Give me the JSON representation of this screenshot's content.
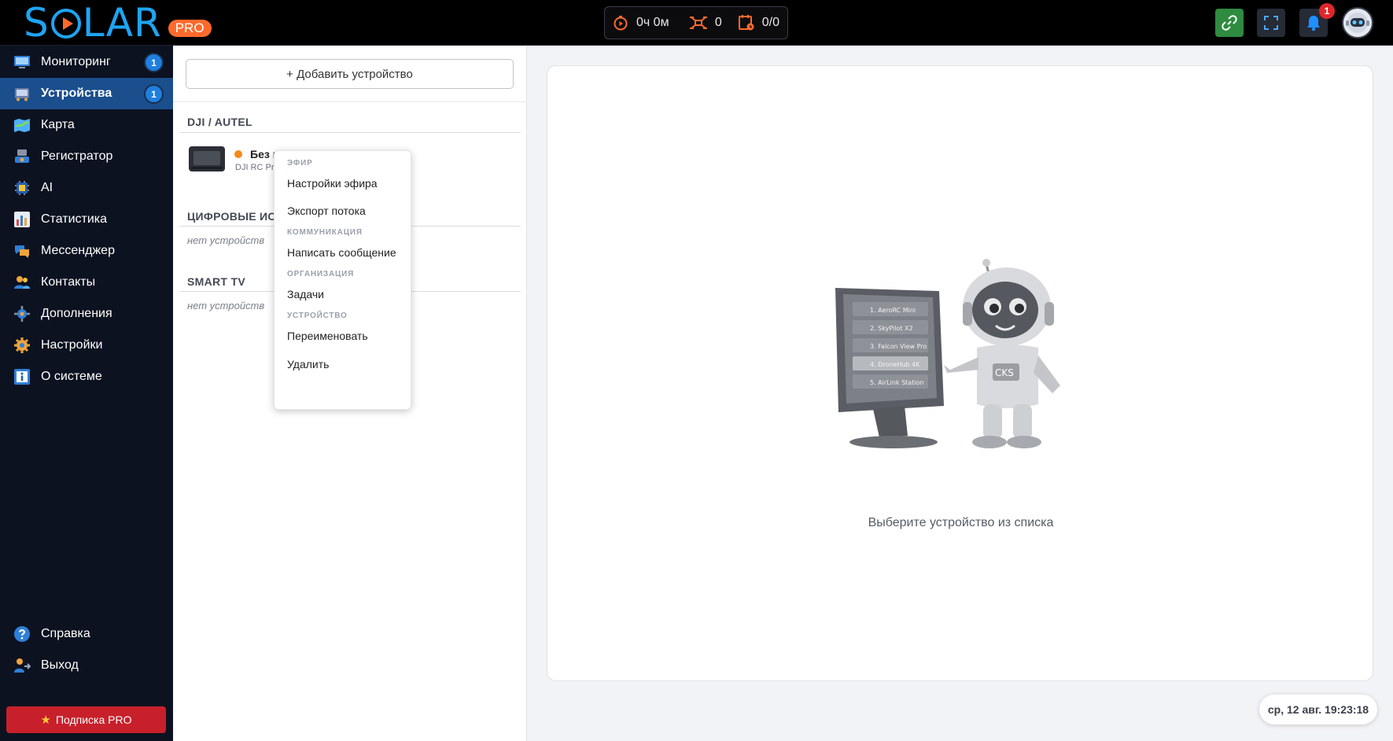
{
  "app": {
    "logo_text": "SOLAR",
    "logo_badge": "PRO",
    "brand_color": "#1ea4f4",
    "accent_color": "#ff6a2c"
  },
  "header": {
    "stats": [
      {
        "icon": "timer-icon",
        "value": "0ч 0м"
      },
      {
        "icon": "drone-icon",
        "value": "0"
      },
      {
        "icon": "calendar-clock-icon",
        "value": "0/0"
      }
    ],
    "notifications_count": "1"
  },
  "sidebar": {
    "items": [
      {
        "label": "Мониторинг",
        "icon": "monitor-icon",
        "badge": "1",
        "active": false
      },
      {
        "label": "Устройства",
        "icon": "devices-icon",
        "badge": "1",
        "active": true
      },
      {
        "label": "Карта",
        "icon": "map-icon",
        "badge": null,
        "active": false
      },
      {
        "label": "Регистратор",
        "icon": "recorder-icon",
        "badge": null,
        "active": false
      },
      {
        "label": "AI",
        "icon": "ai-chip-icon",
        "badge": null,
        "active": false
      },
      {
        "label": "Статистика",
        "icon": "stats-chart-icon",
        "badge": null,
        "active": false
      },
      {
        "label": "Мессенджер",
        "icon": "messenger-icon",
        "badge": null,
        "active": false
      },
      {
        "label": "Контакты",
        "icon": "contacts-icon",
        "badge": null,
        "active": false
      },
      {
        "label": "Дополнения",
        "icon": "addons-icon",
        "badge": null,
        "active": false
      },
      {
        "label": "Настройки",
        "icon": "settings-gear-icon",
        "badge": null,
        "active": false
      },
      {
        "label": "О системе",
        "icon": "info-icon",
        "badge": null,
        "active": false
      }
    ],
    "bottom_items": [
      {
        "label": "Справка",
        "icon": "help-icon"
      },
      {
        "label": "Выход",
        "icon": "logout-icon"
      }
    ],
    "pro_button": "Подписка PRO"
  },
  "devices": {
    "add_button": "+ Добавить устройство",
    "groups": [
      {
        "title": "DJI / AUTEL",
        "empty_text": null
      },
      {
        "title": "ЦИФРОВЫЕ ИСТ",
        "empty_text": "нет устройств"
      },
      {
        "title": "SMART TV",
        "empty_text": "нет устройств"
      }
    ],
    "device": {
      "name": "Без и",
      "model": "DJI RC Pr",
      "status_color": "#f28b1c"
    }
  },
  "context_menu": {
    "sections": [
      {
        "header": "ЭФИР",
        "items": [
          "Настройки эфира",
          "Экспорт потока"
        ]
      },
      {
        "header": "КОММУНИКАЦИЯ",
        "items": [
          "Написать сообщение"
        ]
      },
      {
        "header": "ОРГАНИЗАЦИЯ",
        "items": [
          "Задачи"
        ]
      },
      {
        "header": "УСТРОЙСТВО",
        "items": [
          "Переименовать",
          "Удалить"
        ]
      }
    ]
  },
  "main": {
    "placeholder": "Выберите устройство из списка",
    "illustration_list": [
      "1. AeroRC Mini",
      "2. SkyPilot X2",
      "3. Falcon View Pro",
      "4. DroneHub 4K",
      "5. AirLink Station"
    ],
    "robot_label": "CKS"
  },
  "datetime": "ср, 12 авг. 19:23:18"
}
